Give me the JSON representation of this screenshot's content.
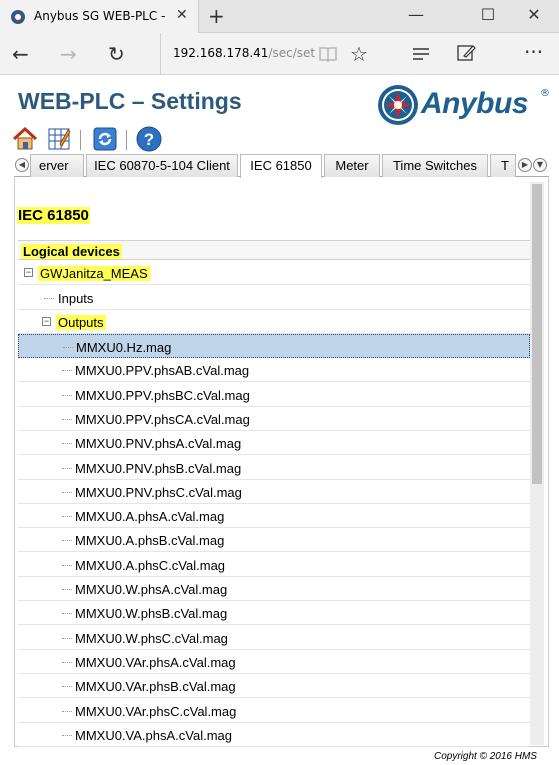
{
  "browser": {
    "tab_title": "Anybus SG WEB-PLC - S",
    "address_host": "192.168.178.41",
    "address_path": "/sec/set"
  },
  "page": {
    "title": "WEB-PLC – Settings",
    "logo_text": "Anybus",
    "logo_reg": "®",
    "copyright": "Copyright © 2016 HMS"
  },
  "toolbar": {
    "icons": [
      "home-icon",
      "grid-icon",
      "refresh-icon",
      "help-icon"
    ]
  },
  "tabs": [
    {
      "label": "erver"
    },
    {
      "label": "IEC 60870-5-104 Client"
    },
    {
      "label": "IEC 61850",
      "active": true
    },
    {
      "label": "Meter"
    },
    {
      "label": "Time Switches"
    },
    {
      "label": "T"
    }
  ],
  "section": {
    "title": "IEC 61850",
    "tree_header": "Logical devices"
  },
  "tree": {
    "device": "GWJanitza_MEAS",
    "inputs": "Inputs",
    "outputs": "Outputs",
    "items": [
      "MMXU0.Hz.mag",
      "MMXU0.PPV.phsAB.cVal.mag",
      "MMXU0.PPV.phsBC.cVal.mag",
      "MMXU0.PPV.phsCA.cVal.mag",
      "MMXU0.PNV.phsA.cVal.mag",
      "MMXU0.PNV.phsB.cVal.mag",
      "MMXU0.PNV.phsC.cVal.mag",
      "MMXU0.A.phsA.cVal.mag",
      "MMXU0.A.phsB.cVal.mag",
      "MMXU0.A.phsC.cVal.mag",
      "MMXU0.W.phsA.cVal.mag",
      "MMXU0.W.phsB.cVal.mag",
      "MMXU0.W.phsC.cVal.mag",
      "MMXU0.VAr.phsA.cVal.mag",
      "MMXU0.VAr.phsB.cVal.mag",
      "MMXU0.VAr.phsC.cVal.mag",
      "MMXU0.VA.phsA.cVal.mag"
    ]
  },
  "colors": {
    "title_blue": "#2d5a7c",
    "highlight_yellow": "#ffff55",
    "selected_row": "#c0d4ea"
  }
}
